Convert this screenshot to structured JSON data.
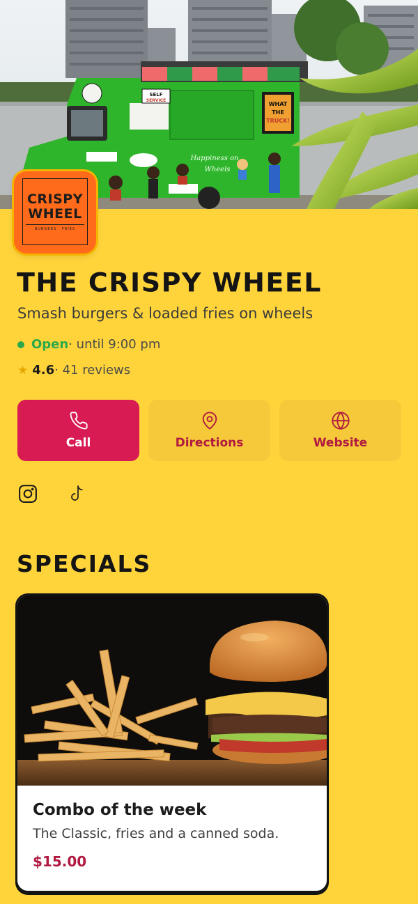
{
  "logo": {
    "line1": "CRISPY",
    "line2": "WHEEL",
    "tagline": "BURGERS · FRIES"
  },
  "hero": {
    "truck_sign": "SELF SERVICE",
    "truck_script_line1": "Happiness on",
    "truck_script_line2": "Wheels",
    "truck_badge": "WHAT THE TRUCK!"
  },
  "business": {
    "name": "The Crispy Wheel",
    "tagline": "Smash burgers & loaded fries on wheels",
    "status": "Open",
    "hours": " · until 9:00 pm",
    "rating": "4.6",
    "reviews": " · 41 reviews"
  },
  "actions": [
    {
      "label": "Call",
      "icon": "phone-icon"
    },
    {
      "label": "Directions",
      "icon": "map-pin-icon"
    },
    {
      "label": "Website",
      "icon": "globe-icon"
    }
  ],
  "social": [
    "instagram-icon",
    "tiktok-icon"
  ],
  "specials": {
    "heading": "Specials",
    "items": [
      {
        "title": "Combo of the week",
        "description": "The Classic, fries and a canned soda.",
        "price": "$15.00"
      }
    ]
  },
  "colors": {
    "background": "#FFD43B",
    "primary": "#D81B52",
    "accent_text": "#B01940",
    "status_open": "#2BA84A",
    "logo_bg": "#FF6B1A"
  }
}
